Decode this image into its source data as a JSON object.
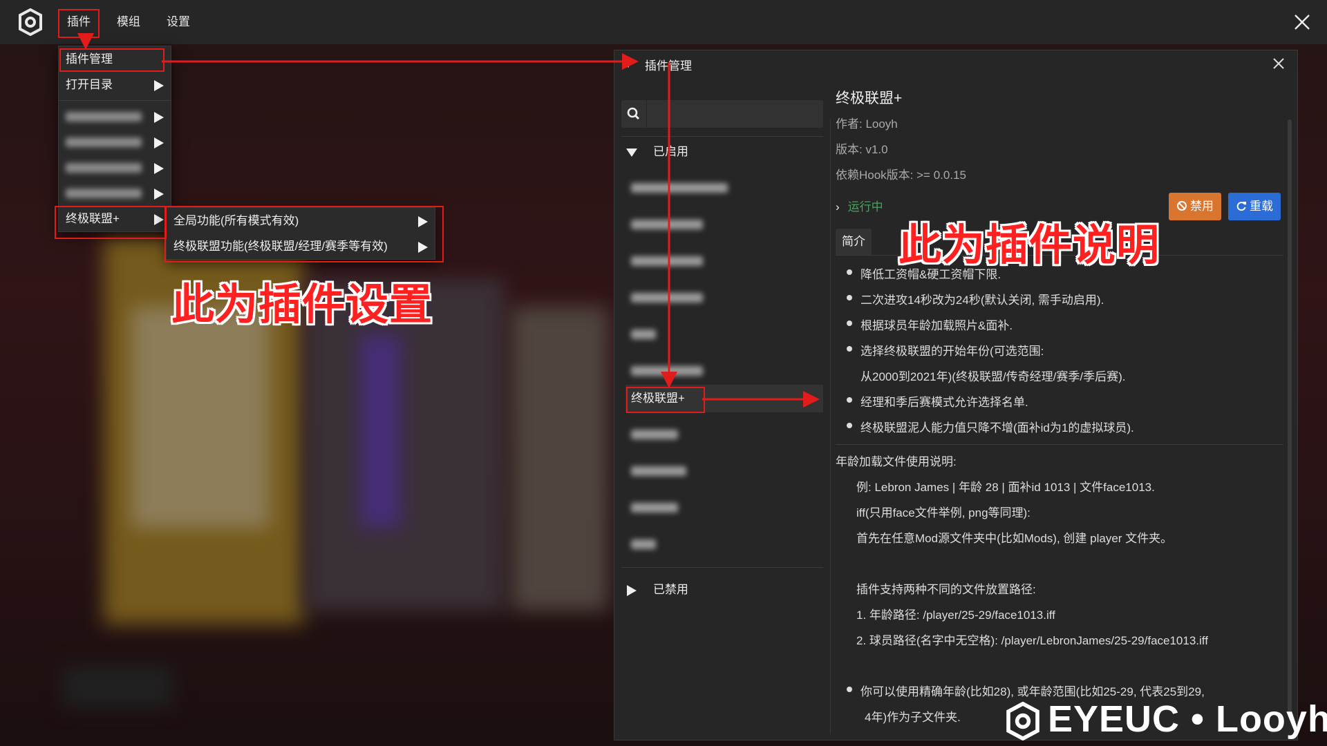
{
  "topbar": {
    "menus": [
      "插件",
      "模组",
      "设置"
    ]
  },
  "plugin_menu": {
    "items": [
      "插件管理",
      "打开目录"
    ],
    "ultimate_label": "终极联盟+"
  },
  "submenu": {
    "items": [
      "全局功能(所有模式有效)",
      "终极联盟功能(终极联盟/经理/赛季等有效)"
    ]
  },
  "annotations": {
    "settings_note": "此为插件设置",
    "description_note": "此为插件说明"
  },
  "dialog": {
    "title": "插件管理",
    "left": {
      "enabled_label": "已启用",
      "selected_item": "终极联盟+",
      "disabled_label": "已禁用"
    },
    "plugin": {
      "name": "终极联盟+",
      "author": "作者:  Looyh",
      "version": "版本:  v1.0",
      "hook_version": "依赖Hook版本:  >= 0.0.15",
      "status": "运行中",
      "disable_label": "禁用",
      "reload_label": "重载",
      "tab_label": "简介"
    },
    "description": {
      "bullets1": [
        "降低工资帽&硬工资帽下限.",
        "二次进攻14秒改为24秒(默认关闭, 需手动启用).",
        "根据球员年龄加载照片&面补.",
        "选择终极联盟的开始年份(可选范围:"
      ],
      "continuation": "从2000到2021年)(终极联盟/传奇经理/赛季/季后赛).",
      "bullets2": [
        "经理和季后赛模式允许选择名单.",
        "终极联盟泥人能力值只降不增(面补id为1的虚拟球员)."
      ],
      "age_heading": "年龄加载文件使用说明:",
      "age_lines": [
        "例: Lebron James | 年龄 28 | 面补id 1013 | 文件face1013.",
        "iff(只用face文件举例, png等同理):",
        "首先在任意Mod源文件夹中(比如Mods), 创建 player 文件夹。"
      ],
      "path_heading": "插件支持两种不同的文件放置路径:",
      "path_lines": [
        "1. 年龄路径: /player/25-29/face1013.iff",
        "2. 球员路径(名字中无空格): /player/LebronJames/25-29/face1013.iff"
      ],
      "final_bullet_1": "你可以使用精确年龄(比如28), 或年龄范围(比如25-29, 代表25到29,",
      "final_bullet_2": "4年)作为子文件夹."
    }
  },
  "watermark": "EYEUC • Looyh",
  "icons": {
    "app_logo": "app-logo-icon",
    "close": "close-icon",
    "search": "search-icon",
    "disable": "ban-icon",
    "reload": "refresh-icon"
  },
  "colors": {
    "annotation_red": "#e21b1b",
    "disable_button": "#d9752f",
    "reload_button": "#2c6cd6",
    "status_green": "#4aa25d"
  }
}
